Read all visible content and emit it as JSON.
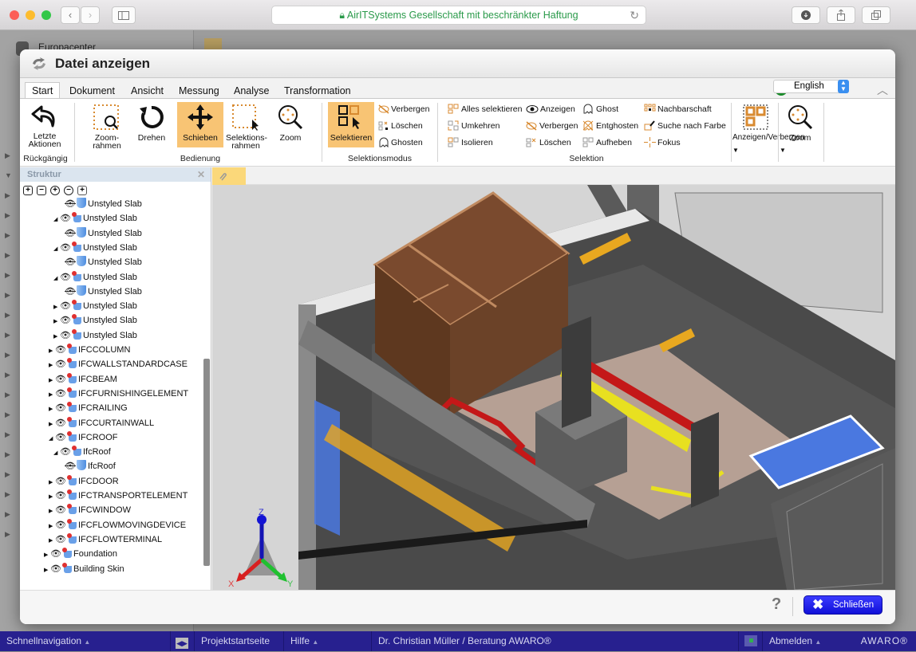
{
  "browser": {
    "url_text": "AirITSystems Gesellschaft mit beschränkter Haftung",
    "lock_icon": "lock-icon",
    "back_label": "‹",
    "forward_label": "›",
    "reload_label": "↻",
    "new_tab_label": "+"
  },
  "background_app": {
    "sidebar_item_label": "Europacenter"
  },
  "dialog": {
    "title": "Datei anzeigen",
    "tabs": [
      {
        "label": "Start",
        "active": true
      },
      {
        "label": "Dokument",
        "active": false
      },
      {
        "label": "Ansicht",
        "active": false
      },
      {
        "label": "Messung",
        "active": false
      },
      {
        "label": "Analyse",
        "active": false
      },
      {
        "label": "Transformation",
        "active": false
      }
    ],
    "language": {
      "selected": "English"
    },
    "ribbon": {
      "undo": {
        "label_line1": "Letzte",
        "label_line2": "Aktionen",
        "group": "Rückgängig"
      },
      "bedienung": {
        "group": "Bedienung",
        "zoom_frame": {
          "line1": "Zoom-",
          "line2": "rahmen"
        },
        "rotate": "Drehen",
        "pan": "Schieben",
        "selection_frame": {
          "line1": "Selektions-",
          "line2": "rahmen"
        },
        "zoom": "Zoom"
      },
      "selektionsmodus": {
        "group": "Selektionsmodus",
        "select": "Selektieren",
        "hide": "Verbergen",
        "delete": "Löschen",
        "ghost": "Ghosten"
      },
      "selektion": {
        "group": "Selektion",
        "col1": [
          "Alles selektieren",
          "Umkehren",
          "Isolieren"
        ],
        "col2": [
          "Anzeigen",
          "Verbergen",
          "Löschen"
        ],
        "col3": [
          "Ghost",
          "Entghosten",
          "Aufheben"
        ],
        "col4": [
          "Nachbarschaft",
          "Suche nach Farbe",
          "Fokus"
        ]
      },
      "show_hide": "Anzeigen/Verbergen",
      "zoom2": "Zoom"
    },
    "structure": {
      "title": "Struktur",
      "tree": [
        {
          "label": "Unstyled Slab",
          "level": 3,
          "expander": "",
          "eye": "hidden",
          "icon": "plain"
        },
        {
          "label": "Unstyled Slab",
          "level": 2,
          "expander": "open",
          "eye": "visible",
          "icon": "group"
        },
        {
          "label": "Unstyled Slab",
          "level": 3,
          "expander": "",
          "eye": "hidden",
          "icon": "plain"
        },
        {
          "label": "Unstyled Slab",
          "level": 2,
          "expander": "open",
          "eye": "visible",
          "icon": "group"
        },
        {
          "label": "Unstyled Slab",
          "level": 3,
          "expander": "",
          "eye": "hidden",
          "icon": "plain"
        },
        {
          "label": "Unstyled Slab",
          "level": 2,
          "expander": "open",
          "eye": "visible",
          "icon": "group"
        },
        {
          "label": "Unstyled Slab",
          "level": 3,
          "expander": "",
          "eye": "hidden",
          "icon": "plain"
        },
        {
          "label": "Unstyled Slab",
          "level": 2,
          "expander": "closed",
          "eye": "visible",
          "icon": "group"
        },
        {
          "label": "Unstyled Slab",
          "level": 2,
          "expander": "closed",
          "eye": "visible",
          "icon": "group"
        },
        {
          "label": "Unstyled Slab",
          "level": 2,
          "expander": "closed",
          "eye": "visible",
          "icon": "group"
        },
        {
          "label": "IFCCOLUMN",
          "level": 1,
          "expander": "closed",
          "eye": "visible",
          "icon": "group"
        },
        {
          "label": "IFCWALLSTANDARDCASE",
          "level": 1,
          "expander": "closed",
          "eye": "visible",
          "icon": "group"
        },
        {
          "label": "IFCBEAM",
          "level": 1,
          "expander": "closed",
          "eye": "visible",
          "icon": "group"
        },
        {
          "label": "IFCFURNISHINGELEMENT",
          "level": 1,
          "expander": "closed",
          "eye": "visible",
          "icon": "group"
        },
        {
          "label": "IFCRAILING",
          "level": 1,
          "expander": "closed",
          "eye": "visible",
          "icon": "group"
        },
        {
          "label": "IFCCURTAINWALL",
          "level": 1,
          "expander": "closed",
          "eye": "visible",
          "icon": "group"
        },
        {
          "label": "IFCROOF",
          "level": 1,
          "expander": "open",
          "eye": "visible",
          "icon": "group"
        },
        {
          "label": "IfcRoof",
          "level": 2,
          "expander": "open",
          "eye": "visible",
          "icon": "group"
        },
        {
          "label": "IfcRoof",
          "level": 3,
          "expander": "",
          "eye": "hidden",
          "icon": "plain"
        },
        {
          "label": "IFCDOOR",
          "level": 1,
          "expander": "closed",
          "eye": "visible",
          "icon": "group"
        },
        {
          "label": "IFCTRANSPORTELEMENT",
          "level": 1,
          "expander": "closed",
          "eye": "visible",
          "icon": "group"
        },
        {
          "label": "IFCWINDOW",
          "level": 1,
          "expander": "closed",
          "eye": "visible",
          "icon": "group"
        },
        {
          "label": "IFCFLOWMOVINGDEVICE",
          "level": 1,
          "expander": "closed",
          "eye": "visible",
          "icon": "group"
        },
        {
          "label": "IFCFLOWTERMINAL",
          "level": 1,
          "expander": "closed",
          "eye": "visible",
          "icon": "group"
        },
        {
          "label": "Foundation",
          "level": 0,
          "expander": "closed",
          "eye": "visible",
          "icon": "group"
        },
        {
          "label": "Building Skin",
          "level": 0,
          "expander": "closed",
          "eye": "visible",
          "icon": "group"
        }
      ]
    },
    "viewer": {
      "axis_labels": {
        "x": "X",
        "y": "Y",
        "z": "Z"
      },
      "colors": {
        "background": "#d5d5d5",
        "steel": "#5a5a5a",
        "wood": "#6b4228",
        "duct_red": "#c41818",
        "duct_yellow": "#f0e020",
        "beam_orange": "#e8a820",
        "glass_blue": "#4a78e0"
      }
    },
    "footer": {
      "help_label": "?",
      "close_label": "Schließen"
    }
  },
  "taskbar": {
    "quick_nav": "Schnellnavigation",
    "project_home": "Projektstartseite",
    "help": "Hilfe",
    "user": "Dr. Christian Müller / Beratung AWARO®",
    "logout": "Abmelden",
    "brand": "AWARO®",
    "color": "#27208f"
  }
}
